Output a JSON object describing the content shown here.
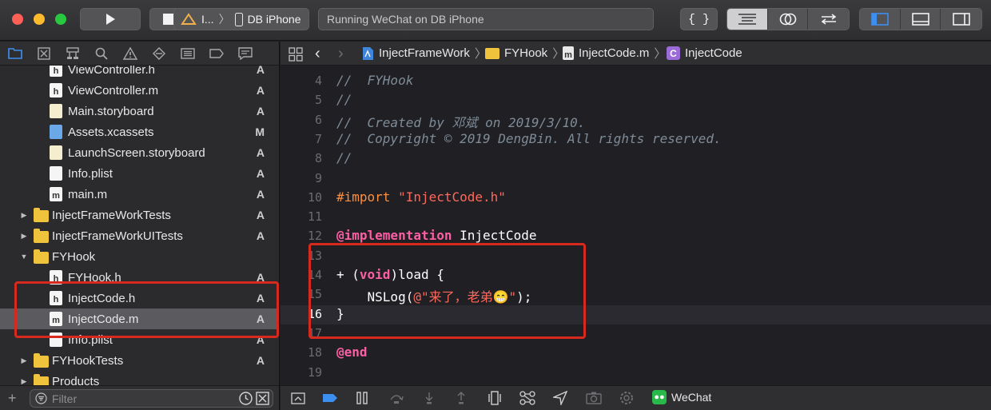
{
  "toolbar": {
    "scheme_app": "I...",
    "device": "DB iPhone",
    "status": "Running WeChat on DB iPhone",
    "library_label": "{ }"
  },
  "navigator": {
    "filter_placeholder": "Filter",
    "rows": [
      {
        "label": "ViewController.h",
        "badge": "A",
        "kind": "h"
      },
      {
        "label": "ViewController.m",
        "badge": "A",
        "kind": "h"
      },
      {
        "label": "Main.storyboard",
        "badge": "A",
        "kind": "story"
      },
      {
        "label": "Assets.xcassets",
        "badge": "M",
        "kind": "assets"
      },
      {
        "label": "LaunchScreen.storyboard",
        "badge": "A",
        "kind": "story"
      },
      {
        "label": "Info.plist",
        "badge": "A",
        "kind": "plist"
      },
      {
        "label": "main.m",
        "badge": "A",
        "kind": "m"
      },
      {
        "label": "InjectFrameWorkTests",
        "badge": "A",
        "kind": "folder"
      },
      {
        "label": "InjectFrameWorkUITests",
        "badge": "A",
        "kind": "folder"
      },
      {
        "label": "FYHook",
        "badge": "",
        "kind": "folder-open"
      },
      {
        "label": "FYHook.h",
        "badge": "A",
        "kind": "h"
      },
      {
        "label": "InjectCode.h",
        "badge": "A",
        "kind": "h"
      },
      {
        "label": "InjectCode.m",
        "badge": "A",
        "kind": "m"
      },
      {
        "label": "Info.plist",
        "badge": "A",
        "kind": "plist"
      },
      {
        "label": "FYHookTests",
        "badge": "A",
        "kind": "folder"
      },
      {
        "label": "Products",
        "badge": "",
        "kind": "folder"
      }
    ]
  },
  "jumpbar": {
    "project": "InjectFrameWork",
    "group": "FYHook",
    "file": "InjectCode.m",
    "symbol": "InjectCode",
    "symbol_badge": "C",
    "file_badge": "m"
  },
  "editor": {
    "lines": [
      {
        "n": "4",
        "text": "//  FYHook"
      },
      {
        "n": "5",
        "text": "//"
      },
      {
        "n": "6",
        "text": "//  Created by 邓斌 on 2019/3/10."
      },
      {
        "n": "7",
        "text": "//  Copyright © 2019 DengBin. All rights reserved."
      },
      {
        "n": "8",
        "text": "//"
      },
      {
        "n": "9",
        "text": ""
      },
      {
        "n": "10",
        "pre": "#import ",
        "str": "\"InjectCode.h\""
      },
      {
        "n": "11",
        "text": ""
      },
      {
        "n": "12",
        "kw": "@implementation",
        "rest": " InjectCode"
      },
      {
        "n": "13",
        "text": ""
      },
      {
        "n": "14",
        "a": "+ (",
        "kw": "void",
        "b": ")load {"
      },
      {
        "n": "15",
        "a": "    NSLog(",
        "str": "@\"来了，老弟😁\"",
        "b": ");"
      },
      {
        "n": "16",
        "text": "}"
      },
      {
        "n": "17",
        "text": ""
      },
      {
        "n": "18",
        "kw": "@end"
      },
      {
        "n": "19",
        "text": ""
      }
    ]
  },
  "debugbar": {
    "target": "WeChat"
  },
  "colors": {
    "accent": "#3d8fef",
    "highlight": "#d7291e",
    "comment": "#7f8c98",
    "keyword": "#fc5fa3",
    "string": "#fc6a5d",
    "preprocessor": "#fd8f3f"
  }
}
